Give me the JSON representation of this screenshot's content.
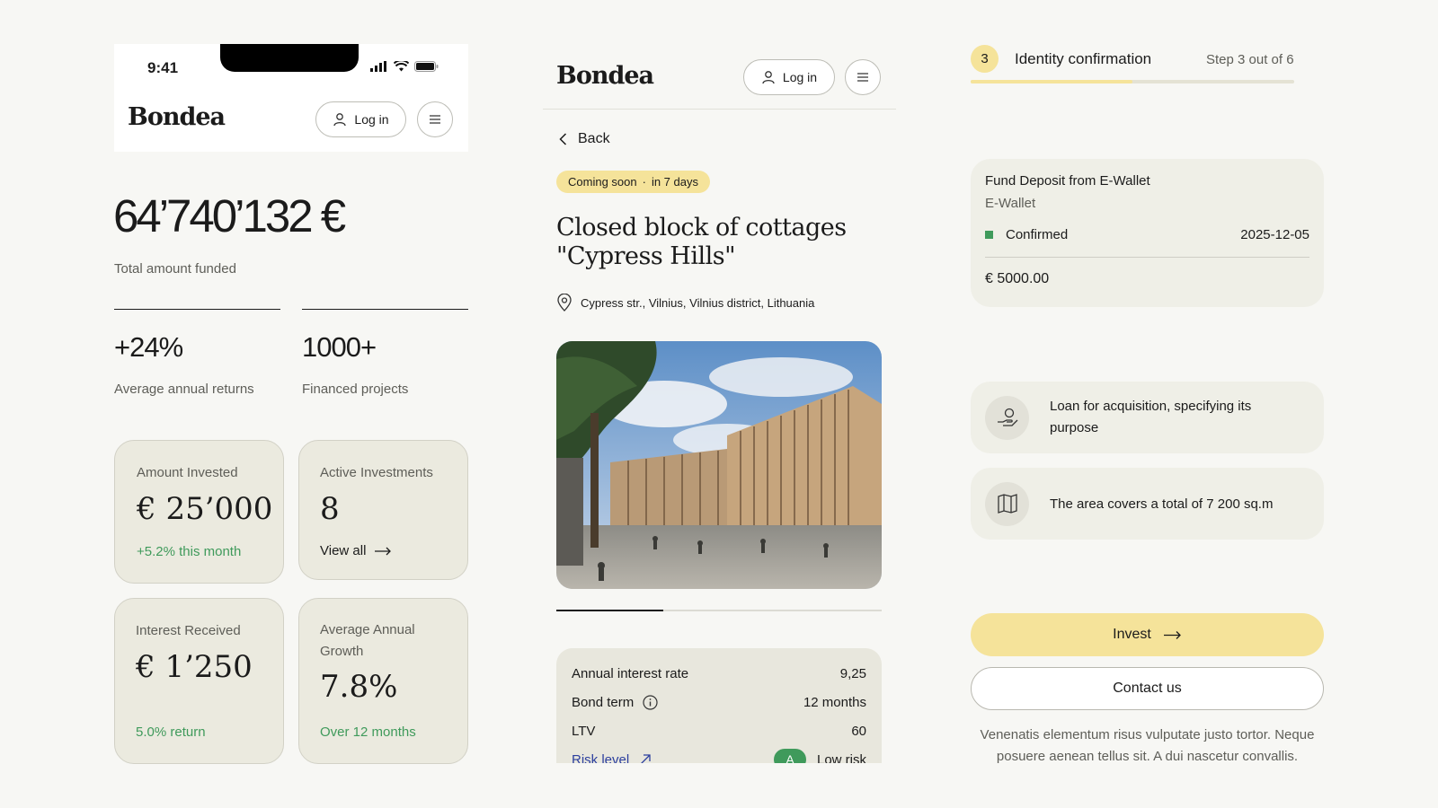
{
  "mobile": {
    "status_time": "9:41",
    "brand": "Bondea",
    "login_label": "Log in",
    "total_amount": "64’740’132 €",
    "total_label": "Total amount funded",
    "stats": [
      {
        "value": "+24%",
        "label": "Average annual returns"
      },
      {
        "value": "1000+",
        "label": "Financed projects"
      }
    ],
    "cards": [
      {
        "label": "Amount Invested",
        "value": "€ 25’000",
        "note": "+5.2% this month"
      },
      {
        "label": "Active Investments",
        "value": "8",
        "link": "View all"
      },
      {
        "label": "Interest Received",
        "value": "€ 1’250",
        "note": "5.0% return"
      },
      {
        "label": "Average Annual Growth",
        "value": "7.8%",
        "note": "Over 12 months"
      }
    ]
  },
  "project": {
    "brand": "Bondea",
    "login_label": "Log in",
    "back_label": "Back",
    "badge_status": "Coming soon",
    "badge_separator": "·",
    "badge_time": "in 7 days",
    "title": "Closed block of cottages \"Cypress Hills\"",
    "address": "Cypress str., Vilnius, Vilnius district, Lithuania",
    "carousel_progress": 0.33,
    "stats": {
      "interest_label": "Annual interest rate",
      "interest_value": "9,25",
      "term_label": "Bond term",
      "term_value": "12 months",
      "ltv_label": "LTV",
      "ltv_value": "60",
      "risk_label": "Risk level",
      "risk_grade": "A",
      "risk_value": "Low risk"
    }
  },
  "identity": {
    "step_number": "3",
    "step_title": "Identity confirmation",
    "step_count": "Step 3 out of 6",
    "progress": 0.5,
    "deposit": {
      "title": "Fund Deposit from E-Wallet",
      "source": "E-Wallet",
      "status": "Confirmed",
      "date": "2025-12-05",
      "amount": "€ 5000.00"
    },
    "features": [
      {
        "icon": "hand-coin-icon",
        "text": "Loan for acquisition, specifying its purpose"
      },
      {
        "icon": "map-icon",
        "text": "The area covers a total of 7 200 sq.m"
      }
    ],
    "invest_label": "Invest",
    "contact_label": "Contact us",
    "disclaimer": "Venenatis elementum risus vulputate justo tortor. Neque posuere aenean tellus sit. A dui nascetur convallis."
  },
  "colors": {
    "accent": "#f5e39a",
    "positive": "#3f9a5b",
    "card_bg": "#ebeadf",
    "link": "#2c3f9e"
  }
}
